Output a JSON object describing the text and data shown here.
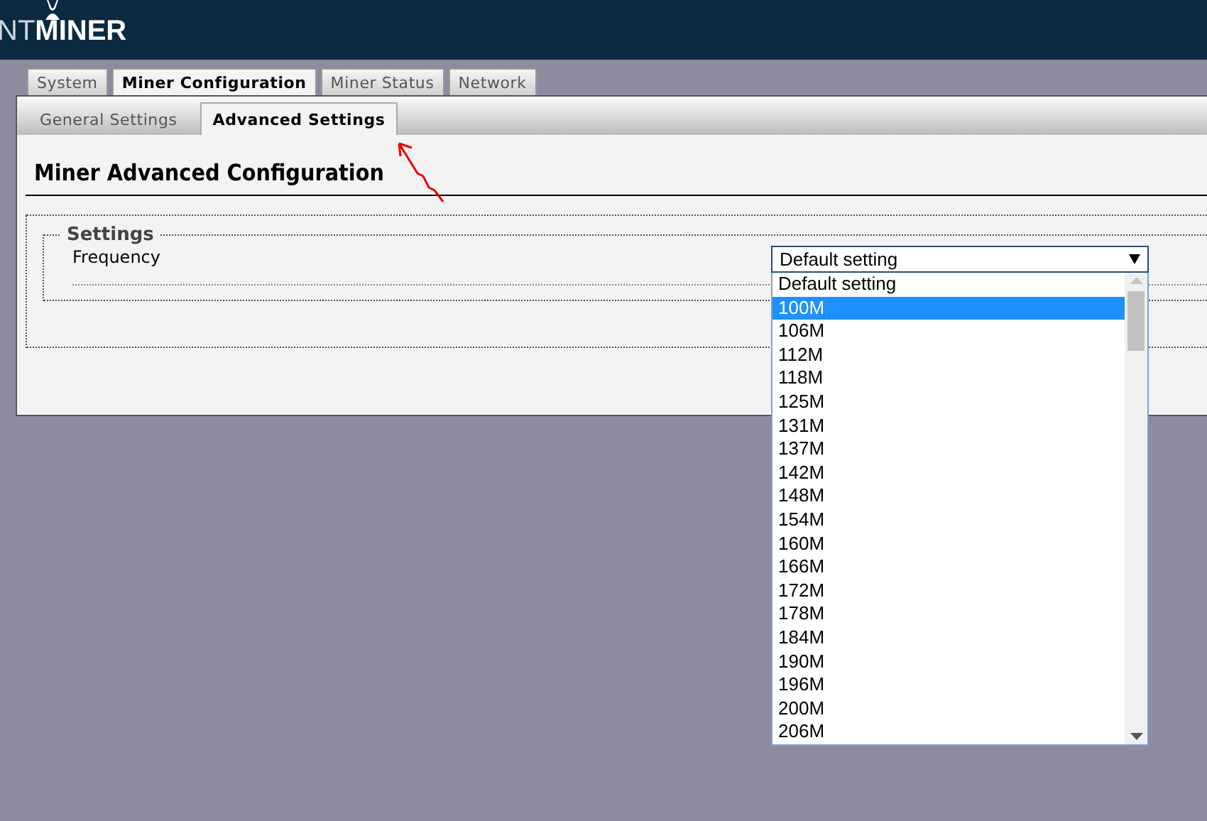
{
  "header": {
    "logo_light": "NT",
    "logo_bold": "MINER"
  },
  "tabs": [
    {
      "label": "System",
      "selected": false
    },
    {
      "label": "Miner Configuration",
      "selected": true
    },
    {
      "label": "Miner Status",
      "selected": false
    },
    {
      "label": "Network",
      "selected": false
    }
  ],
  "subtabs": [
    {
      "label": "General Settings",
      "selected": false
    },
    {
      "label": "Advanced Settings",
      "selected": true
    }
  ],
  "page_title": "Miner Advanced Configuration",
  "settings": {
    "legend": "Settings",
    "field_label": "Frequency",
    "value": "Default setting",
    "expanded": true,
    "options": [
      {
        "label": "Default setting",
        "highlighted": false
      },
      {
        "label": "100M",
        "highlighted": true
      },
      {
        "label": "106M",
        "highlighted": false
      },
      {
        "label": "112M",
        "highlighted": false
      },
      {
        "label": "118M",
        "highlighted": false
      },
      {
        "label": "125M",
        "highlighted": false
      },
      {
        "label": "131M",
        "highlighted": false
      },
      {
        "label": "137M",
        "highlighted": false
      },
      {
        "label": "142M",
        "highlighted": false
      },
      {
        "label": "148M",
        "highlighted": false
      },
      {
        "label": "154M",
        "highlighted": false
      },
      {
        "label": "160M",
        "highlighted": false
      },
      {
        "label": "166M",
        "highlighted": false
      },
      {
        "label": "172M",
        "highlighted": false
      },
      {
        "label": "178M",
        "highlighted": false
      },
      {
        "label": "184M",
        "highlighted": false
      },
      {
        "label": "190M",
        "highlighted": false
      },
      {
        "label": "196M",
        "highlighted": false
      },
      {
        "label": "200M",
        "highlighted": false
      },
      {
        "label": "206M",
        "highlighted": false
      }
    ]
  }
}
